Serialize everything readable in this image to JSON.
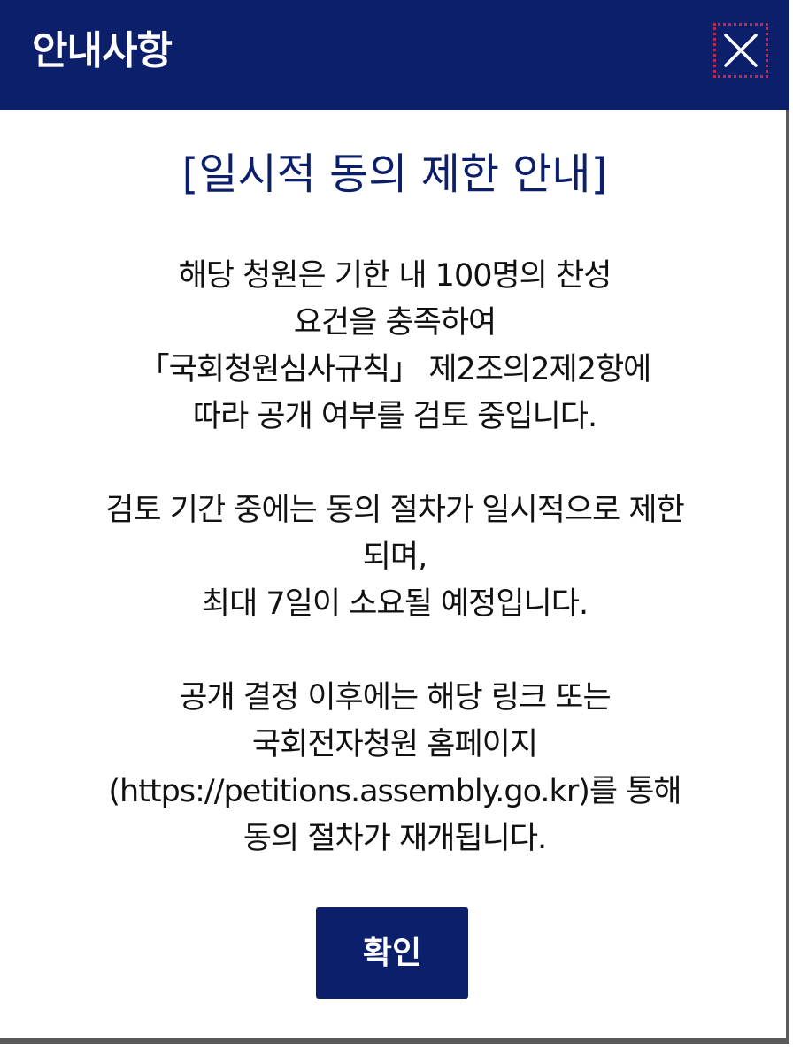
{
  "modal": {
    "title": "안내사항",
    "close_icon": "close-icon",
    "heading": "[일시적 동의 제한 안내]",
    "body_lines": [
      "해당 청원은 기한 내 100명의 찬성",
      "요건을 충족하여",
      "「국회청원심사규칙」 제2조의2제2항에",
      "따라 공개 여부를 검토 중입니다.",
      "",
      "검토 기간 중에는 동의 절차가 일시적으로 제한",
      "되며,",
      "최대 7일이 소요될 예정입니다.",
      "",
      "공개 결정 이후에는 해당 링크 또는",
      "국회전자청원 홈페이지",
      "(https://petitions.assembly.go.kr)를 통해",
      "동의 절차가 재개됩니다."
    ],
    "confirm_label": "확인"
  },
  "colors": {
    "header_bg": "#0c1f6b",
    "heading_text": "#0c1f6b",
    "button_bg": "#0c1f6b",
    "focus_outline": "#c8294a"
  }
}
